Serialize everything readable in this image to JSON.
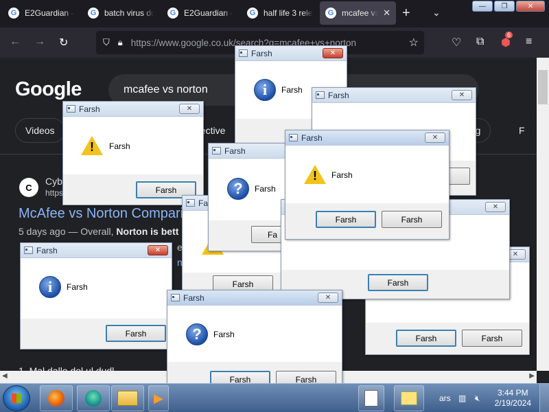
{
  "browser": {
    "tabs": [
      {
        "label": "E2Guardian -",
        "active": false
      },
      {
        "label": "batch virus do",
        "active": false
      },
      {
        "label": "E2Guardian -",
        "active": false
      },
      {
        "label": "half life 3 rele",
        "active": false
      },
      {
        "label": "mcafee vs",
        "active": true
      }
    ],
    "tab_close_glyph": "✕",
    "new_tab_glyph": "+",
    "list_tabs_glyph": "⌄",
    "url": "https://www.google.co.uk/search?q=mcafee+vs+norton",
    "extension_badge": "6",
    "window_controls": {
      "minimize": "—",
      "maximize": "❐",
      "close": "✕"
    }
  },
  "google": {
    "logo": "Google",
    "query": "mcafee vs norton",
    "chips": [
      "Videos",
      "pective",
      "ping",
      "F"
    ],
    "result": {
      "site_name": "Cyb",
      "site_url": "https",
      "favicon_text": "C",
      "title": "McAfee vs Norton Compari",
      "snippet_prefix": "5 days ago — Overall, ",
      "snippet_bold": "Norton is bett",
      "snippet_line2": "esi",
      "snippet_line3": "ns"
    },
    "bottom_text": "1. Mal         dallo  dol  ul  dudl"
  },
  "dialogs": [
    {
      "title": "Farsh",
      "message": "Farsh",
      "icon": "info-icon",
      "buttons": [],
      "close_style": "red"
    },
    {
      "title": "Farsh",
      "message": "Farsh",
      "icon": "warning-icon",
      "buttons": [
        "Farsh"
      ],
      "close_style": "normal"
    },
    {
      "title": "Farsh",
      "message": "",
      "icon": "warning-icon",
      "buttons": [],
      "close_style": "normal"
    },
    {
      "title": "Farsh",
      "message": "Farsh",
      "icon": "question-icon",
      "buttons": [
        "Fa"
      ],
      "close_style": "normal"
    },
    {
      "title": "Farsh",
      "message": "Farsh",
      "icon": "warning-icon",
      "buttons": [
        "Farsh",
        "Farsh"
      ],
      "close_style": "normal"
    },
    {
      "title": "Fa",
      "message": "",
      "icon": "warning-icon",
      "buttons": [
        "Farsh"
      ],
      "close_style": "normal"
    },
    {
      "title": "Farsh",
      "message": "Farsh",
      "icon": "info-icon",
      "buttons": [
        "Farsh"
      ],
      "close_style": "red"
    },
    {
      "title": "",
      "message": "",
      "icon": "info-icon",
      "buttons": [
        "Farsh"
      ],
      "close_style": "normal"
    },
    {
      "title": "",
      "message": "",
      "icon": "",
      "buttons": [
        "Farsh",
        "Farsh"
      ],
      "close_style": "normal"
    },
    {
      "title": "Farsh",
      "message": "Farsh",
      "icon": "question-icon",
      "buttons": [
        "Farsh",
        "Farsh"
      ],
      "close_style": "normal"
    }
  ],
  "taskbar": {
    "tray_text": "ars",
    "time": "3:44 PM",
    "date": "2/19/2024"
  }
}
